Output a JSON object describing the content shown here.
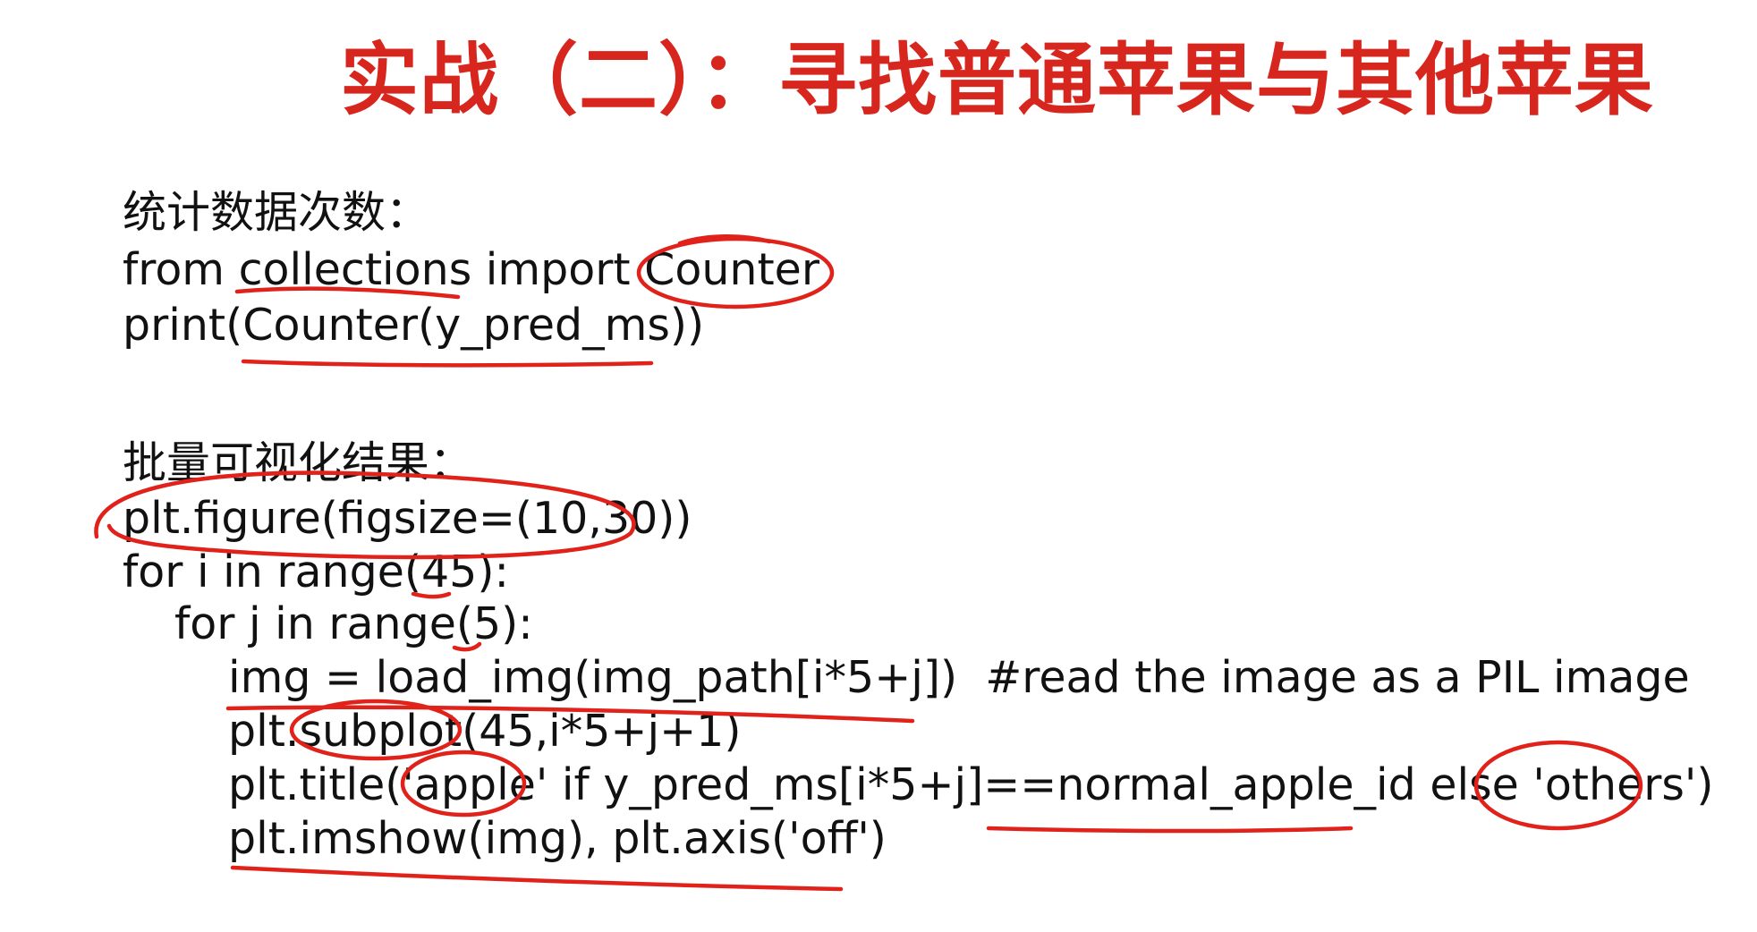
{
  "title": "实战（二）：寻找普通苹果与其他苹果",
  "section1": {
    "heading": "统计数据次数：",
    "lines": [
      "from collections import Counter",
      "print(Counter(y_pred_ms))"
    ]
  },
  "section2": {
    "heading": "批量可视化结果：",
    "lines": [
      "plt.figure(figsize=(10,30))",
      "for i in range(45):",
      "for j in range(5):",
      "img = load_img(img_path[i*5+j])  #read the image as a PIL image",
      "plt.subplot(45,i*5+j+1)",
      "plt.title('apple' if y_pred_ms[i*5+j]==normal_apple_id else 'others')",
      "plt.imshow(img), plt.axis('off')"
    ]
  },
  "colors": {
    "title": "#d7261e",
    "text": "#111111",
    "annotation": "#e0221b"
  }
}
